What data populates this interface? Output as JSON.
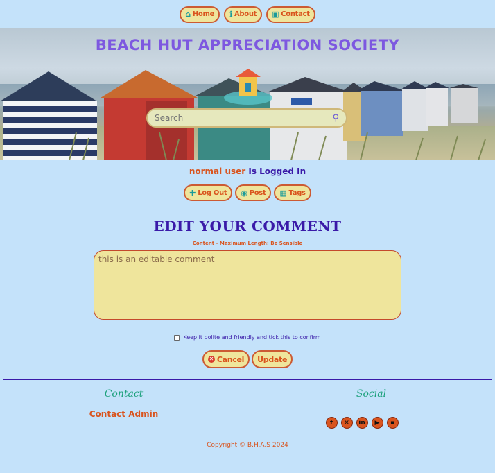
{
  "nav": [
    {
      "label": "Home",
      "icon": "home-icon",
      "glyph": "⌂"
    },
    {
      "label": "About",
      "icon": "info-icon",
      "glyph": "ℹ"
    },
    {
      "label": "Contact",
      "icon": "contact-card-icon",
      "glyph": "▣"
    }
  ],
  "hero": {
    "title": "BEACH HUT APPRECIATION SOCIETY"
  },
  "search": {
    "placeholder": "Search",
    "value": ""
  },
  "status": {
    "username": "normal user",
    "suffix": "Is Logged In"
  },
  "actions": [
    {
      "label": "Log Out",
      "icon": "user-plus-icon",
      "glyph": "👥"
    },
    {
      "label": "Post",
      "icon": "comment-icon",
      "glyph": "◉"
    },
    {
      "label": "Tags",
      "icon": "tags-icon",
      "glyph": "▦"
    }
  ],
  "form": {
    "title": "EDIT YOUR COMMENT",
    "content_label": "Content - Maximum Length: Be Sensible",
    "comment_value": "this is an editable comment",
    "confirm_text": "Keep it polite and friendly and tick this to confirm",
    "cancel_label": "Cancel",
    "update_label": "Update"
  },
  "footer": {
    "contact_heading": "Contact",
    "contact_link": "Contact Admin",
    "social_heading": "Social",
    "social_icons": [
      "facebook-icon",
      "x-twitter-icon",
      "linkedin-icon",
      "youtube-icon",
      "flickr-icon"
    ],
    "copyright": "Copyright © B.H.A.S 2024"
  },
  "colors": {
    "background": "#c4e2fa",
    "accent": "#d9541e",
    "button_bg": "#efe59c",
    "heading": "#3a1aa8"
  }
}
